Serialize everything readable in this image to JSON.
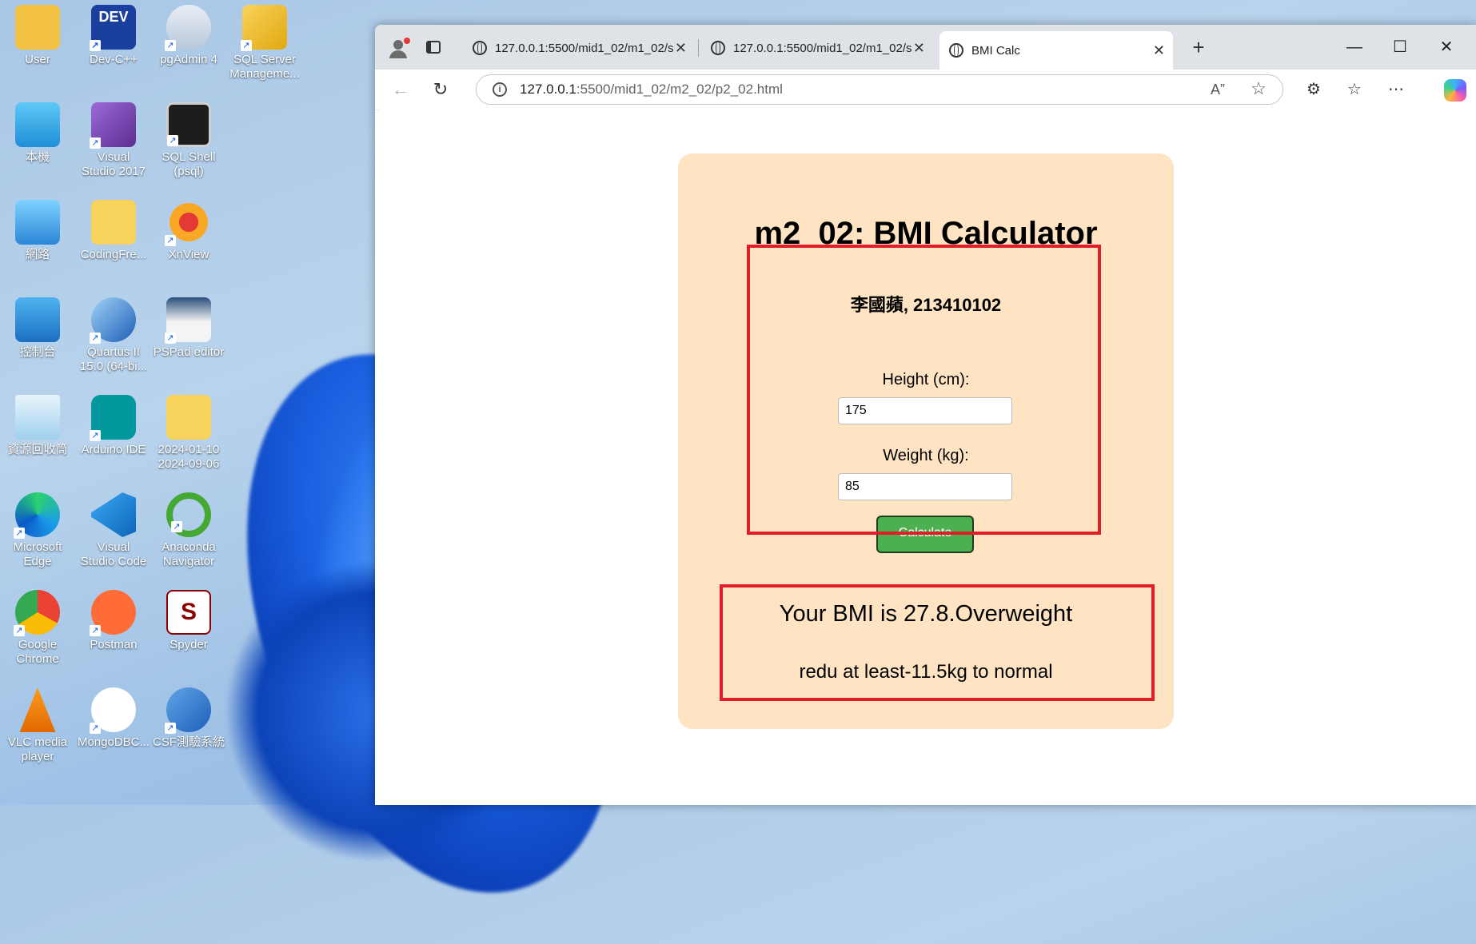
{
  "desktop": {
    "icons": [
      {
        "label": "User"
      },
      {
        "label": "Dev-C++"
      },
      {
        "label": "pgAdmin 4"
      },
      {
        "label": "SQL Server\nManageme..."
      },
      {
        "label": "本機"
      },
      {
        "label": "Visual\nStudio 2017"
      },
      {
        "label": "SQL Shell\n(psql)"
      },
      {
        "label": "網路"
      },
      {
        "label": "CodingFre..."
      },
      {
        "label": "XnView"
      },
      {
        "label": "控制台"
      },
      {
        "label": "Quartus II\n15.0 (64-bi..."
      },
      {
        "label": "PSPad editor"
      },
      {
        "label": "資源回收筒"
      },
      {
        "label": "Arduino IDE"
      },
      {
        "label": "2024-01-10\n2024-09-06"
      },
      {
        "label": "Microsoft\nEdge"
      },
      {
        "label": "Visual\nStudio Code"
      },
      {
        "label": "Anaconda\nNavigator"
      },
      {
        "label": "Google\nChrome"
      },
      {
        "label": "Postman"
      },
      {
        "label": "Spyder"
      },
      {
        "label": "VLC media\nplayer"
      },
      {
        "label": "MongoDBC..."
      },
      {
        "label": "CSF測驗系統"
      }
    ]
  },
  "browser": {
    "tabs": [
      {
        "title": "127.0.0.1:5500/mid1_02/m1_02/s"
      },
      {
        "title": "127.0.0.1:5500/mid1_02/m1_02/s"
      },
      {
        "title": "BMI Calc"
      }
    ],
    "url_host": "127.0.0.1",
    "url_rest": ":5500/mid1_02/m2_02/p2_02.html"
  },
  "page": {
    "title": "m2_02: BMI Calculator",
    "author": "李國蘋, 213410102",
    "height_label": "Height (cm):",
    "height_value": "175",
    "weight_label": "Weight (kg):",
    "weight_value": "85",
    "calculate_label": "Calculate",
    "result_bmi": "Your BMI is 27.8.Overweight",
    "result_advice": "redu at least-11.5kg to normal"
  },
  "colors": {
    "card_bg": "#ffe4c4",
    "button_bg": "#4caf50",
    "highlight": "#e11d2a"
  }
}
